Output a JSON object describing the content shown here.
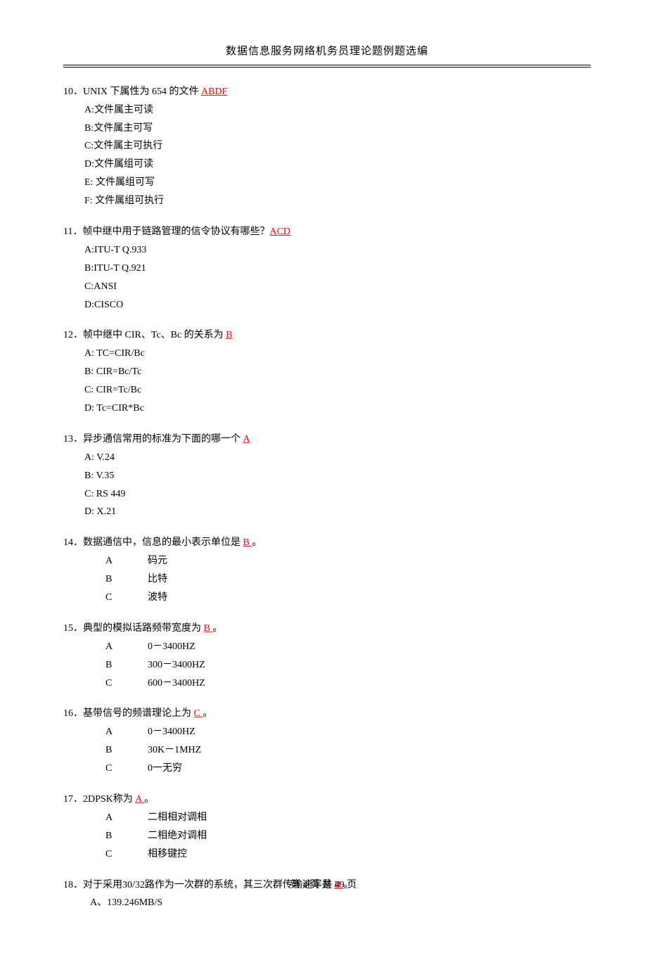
{
  "header": {
    "title": "数据信息服务网络机务员理论题例题选编"
  },
  "questions": [
    {
      "num": "10．",
      "text": "UNIX 下属性为 654 的文件 ",
      "answer": "ABDF",
      "suffix": "",
      "options": [
        "A:文件属主可读",
        "B:文件属主可写",
        "C:文件属主可执行",
        "D:文件属组可读",
        "E:  文件属组可写",
        "F:  文件属组可执行"
      ],
      "wide": false
    },
    {
      "num": "11．",
      "text": "帧中继中用于链路管理的信令协议有哪些？",
      "answer": "ACD",
      "suffix": "",
      "options": [
        "A:ITU-T Q.933",
        "B:ITU-T Q.921",
        "C:ANSI",
        "D:CISCO"
      ],
      "wide": false
    },
    {
      "num": "12．",
      "text": "帧中继中 CIR、Tc、Bc 的关系为 ",
      "answer": "B",
      "suffix": "",
      "options": [
        "A: TC=CIR/Bc",
        "B: CIR=Bc/Tc",
        "C: CIR=Tc/Bc",
        "D: Tc=CIR*Bc"
      ],
      "wide": false
    },
    {
      "num": "13．",
      "text": "异步通信常用的标准为下面的哪一个 ",
      "answer": "A",
      "suffix": "",
      "options": [
        "A: V.24",
        "B: V.35",
        "C: RS 449",
        "D: X.21"
      ],
      "wide": false
    },
    {
      "num": "14．",
      "text": "数据通信中，信息的最小表示单位是 ",
      "answer": "  B  ",
      "suffix": " 。",
      "options_wide": [
        {
          "letter": "A",
          "text": "码元"
        },
        {
          "letter": "B",
          "text": "比特"
        },
        {
          "letter": "C",
          "text": "波特"
        }
      ],
      "wide": true
    },
    {
      "num": "15．",
      "text": "典型的模拟话路频带宽度为 ",
      "answer": "  B   ",
      "suffix": "  。",
      "options_wide": [
        {
          "letter": "A",
          "text": "0－3400HZ"
        },
        {
          "letter": "B",
          "text": "300－3400HZ"
        },
        {
          "letter": "C",
          "text": "600－3400HZ"
        }
      ],
      "wide": true
    },
    {
      "num": "16．",
      "text": "基带信号的频谱理论上为 ",
      "answer": "  C   ",
      "suffix": "   。",
      "options_wide": [
        {
          "letter": "A",
          "text": "0－3400HZ"
        },
        {
          "letter": "B",
          "text": "30K－1MHZ"
        },
        {
          "letter": "C",
          "text": "0一无穷"
        }
      ],
      "wide": true
    },
    {
      "num": "17．",
      "text": "2DPSK称为 ",
      "answer": "  A   ",
      "suffix": "  。",
      "options_wide": [
        {
          "letter": "A",
          "text": "二相相对调相"
        },
        {
          "letter": "B",
          "text": "二相绝对调相"
        },
        {
          "letter": "C",
          "text": "相移键控"
        }
      ],
      "wide": true
    },
    {
      "num": "18．",
      "text": "对于采用30/32路作为一次群的系统，其三次群传输速率是 ",
      "answer": "  B  ",
      "suffix": " 。",
      "options": [
        "A、139.246MB/S"
      ],
      "wide": false,
      "indent_opts": true
    }
  ],
  "footer": {
    "text": "第 4 页 共 49 页"
  }
}
